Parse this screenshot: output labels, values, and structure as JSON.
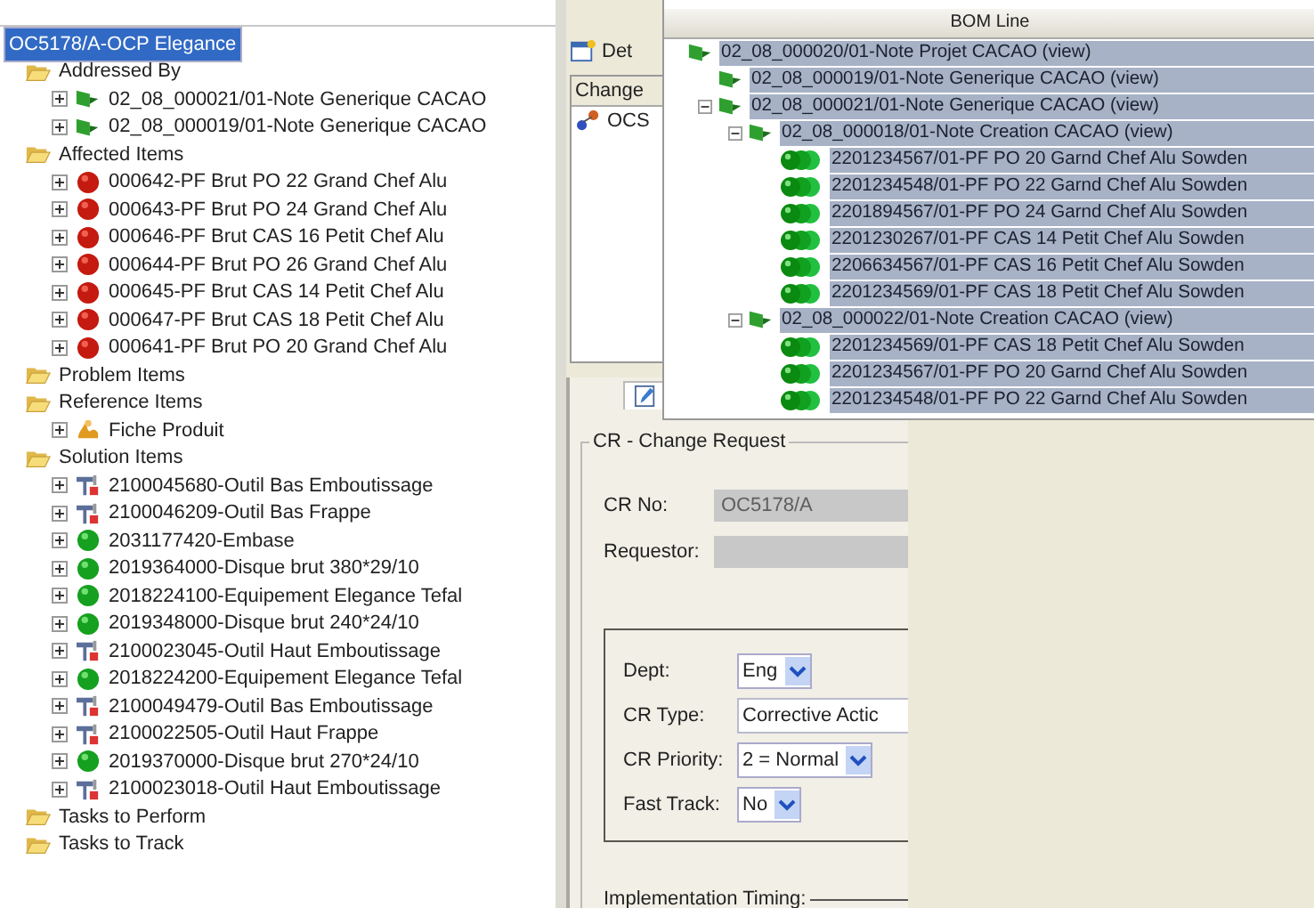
{
  "object_tree": {
    "root": {
      "label": "OC5178/A-OCP Elegance",
      "selected": true
    },
    "folders": [
      {
        "label": "Addressed By",
        "items": [
          {
            "kind": "note",
            "label": "02_08_000021/01-Note Generique CACAO",
            "expanded": false
          },
          {
            "kind": "note",
            "label": "02_08_000019/01-Note Generique CACAO",
            "expanded": false
          }
        ]
      },
      {
        "label": "Affected Items",
        "items": [
          {
            "kind": "red-part",
            "label": "000642-PF Brut PO 22 Grand Chef Alu",
            "expanded": false
          },
          {
            "kind": "red-part",
            "label": "000643-PF Brut PO 24 Grand Chef Alu",
            "expanded": false
          },
          {
            "kind": "red-part",
            "label": "000646-PF Brut CAS 16 Petit Chef Alu",
            "expanded": false
          },
          {
            "kind": "red-part",
            "label": "000644-PF Brut PO 26 Grand Chef Alu",
            "expanded": false
          },
          {
            "kind": "red-part",
            "label": "000645-PF Brut CAS 14 Petit Chef Alu",
            "expanded": false
          },
          {
            "kind": "red-part",
            "label": "000647-PF Brut CAS 18 Petit Chef Alu",
            "expanded": false
          },
          {
            "kind": "red-part",
            "label": "000641-PF Brut PO 20 Grand Chef Alu",
            "expanded": false
          }
        ]
      },
      {
        "label": "Problem Items"
      },
      {
        "label": "Reference Items",
        "items": [
          {
            "kind": "form",
            "label": "Fiche Produit",
            "expanded": false
          }
        ]
      },
      {
        "label": "Solution Items",
        "items": [
          {
            "kind": "tool",
            "label": "2100045680-Outil Bas Emboutissage",
            "expanded": false
          },
          {
            "kind": "tool",
            "label": "2100046209-Outil Bas Frappe",
            "expanded": false
          },
          {
            "kind": "green-part",
            "label": "2031177420-Embase",
            "expanded": false
          },
          {
            "kind": "green-part",
            "label": "2019364000-Disque brut 380*29/10",
            "expanded": false
          },
          {
            "kind": "green-part",
            "label": "2018224100-Equipement Elegance Tefal",
            "expanded": false
          },
          {
            "kind": "green-part",
            "label": "2019348000-Disque brut 240*24/10",
            "expanded": false
          },
          {
            "kind": "tool",
            "label": "2100023045-Outil Haut Emboutissage",
            "expanded": false
          },
          {
            "kind": "green-part",
            "label": "2018224200-Equipement Elegance Tefal",
            "expanded": false
          },
          {
            "kind": "tool",
            "label": "2100049479-Outil Bas Emboutissage",
            "expanded": false
          },
          {
            "kind": "tool",
            "label": "2100022505-Outil Haut Frappe",
            "expanded": false
          },
          {
            "kind": "green-part",
            "label": "2019370000-Disque brut 270*24/10",
            "expanded": false
          },
          {
            "kind": "tool",
            "label": "2100023018-Outil Haut Emboutissage",
            "expanded": false
          }
        ]
      },
      {
        "label": "Tasks to Perform"
      },
      {
        "label": "Tasks to Track"
      }
    ]
  },
  "details_tab": {
    "label": "Det"
  },
  "change_table": {
    "column": "Change",
    "rows": [
      "OCS"
    ]
  },
  "bom_popup": {
    "title": "BOM Line",
    "tree": [
      {
        "kind": "note",
        "label": "02_08_000020/01-Note Projet CACAO (view)",
        "selected": true,
        "children": [
          {
            "kind": "note",
            "label": "02_08_000019/01-Note Generique CACAO (view)",
            "selected": true
          },
          {
            "kind": "note",
            "label": "02_08_000021/01-Note Generique CACAO (view)",
            "selected": true,
            "expanded": true,
            "children": [
              {
                "kind": "note",
                "label": "02_08_000018/01-Note Creation CACAO (view)",
                "selected": true,
                "expanded": true,
                "children": [
                  {
                    "kind": "part",
                    "label": "2201234567/01-PF PO 20 Garnd Chef Alu Sowden",
                    "selected": true
                  },
                  {
                    "kind": "part",
                    "label": "2201234548/01-PF PO 22 Garnd Chef Alu Sowden",
                    "selected": true
                  },
                  {
                    "kind": "part",
                    "label": "2201894567/01-PF PO 24 Garnd Chef Alu Sowden",
                    "selected": true
                  },
                  {
                    "kind": "part",
                    "label": "2201230267/01-PF CAS 14 Petit Chef Alu Sowden",
                    "selected": true
                  },
                  {
                    "kind": "part",
                    "label": "2206634567/01-PF CAS 16 Petit Chef Alu Sowden",
                    "selected": true
                  },
                  {
                    "kind": "part",
                    "label": "2201234569/01-PF CAS 18 Petit Chef Alu Sowden",
                    "selected": true
                  }
                ]
              },
              {
                "kind": "note",
                "label": "02_08_000022/01-Note Creation CACAO (view)",
                "selected": true,
                "expanded": true,
                "children": [
                  {
                    "kind": "part",
                    "label": "2201234569/01-PF CAS 18 Petit Chef Alu Sowden",
                    "selected": true
                  },
                  {
                    "kind": "part",
                    "label": "2201234567/01-PF PO 20 Garnd Chef Alu Sowden",
                    "selected": true
                  },
                  {
                    "kind": "part",
                    "label": "2201234548/01-PF PO 22 Garnd Chef Alu Sowden",
                    "selected": true
                  }
                ]
              }
            ]
          }
        ]
      }
    ]
  },
  "change_request": {
    "title": "CR - Change Request",
    "fields": [
      {
        "label": "CR No:",
        "value": "OC5178/A",
        "disabled": true
      },
      {
        "label": "Requestor:",
        "disabled": true
      }
    ],
    "options": [
      {
        "kind": "select",
        "label": "Dept:",
        "value": "Eng"
      },
      {
        "kind": "text",
        "label": "CR Type:",
        "value": "Corrective Actic"
      },
      {
        "kind": "select",
        "label": "CR Priority:",
        "value": "2 = Normal"
      },
      {
        "kind": "select",
        "label": "Fast Track:",
        "value": "No"
      }
    ],
    "section": "Implementation Timing:"
  }
}
